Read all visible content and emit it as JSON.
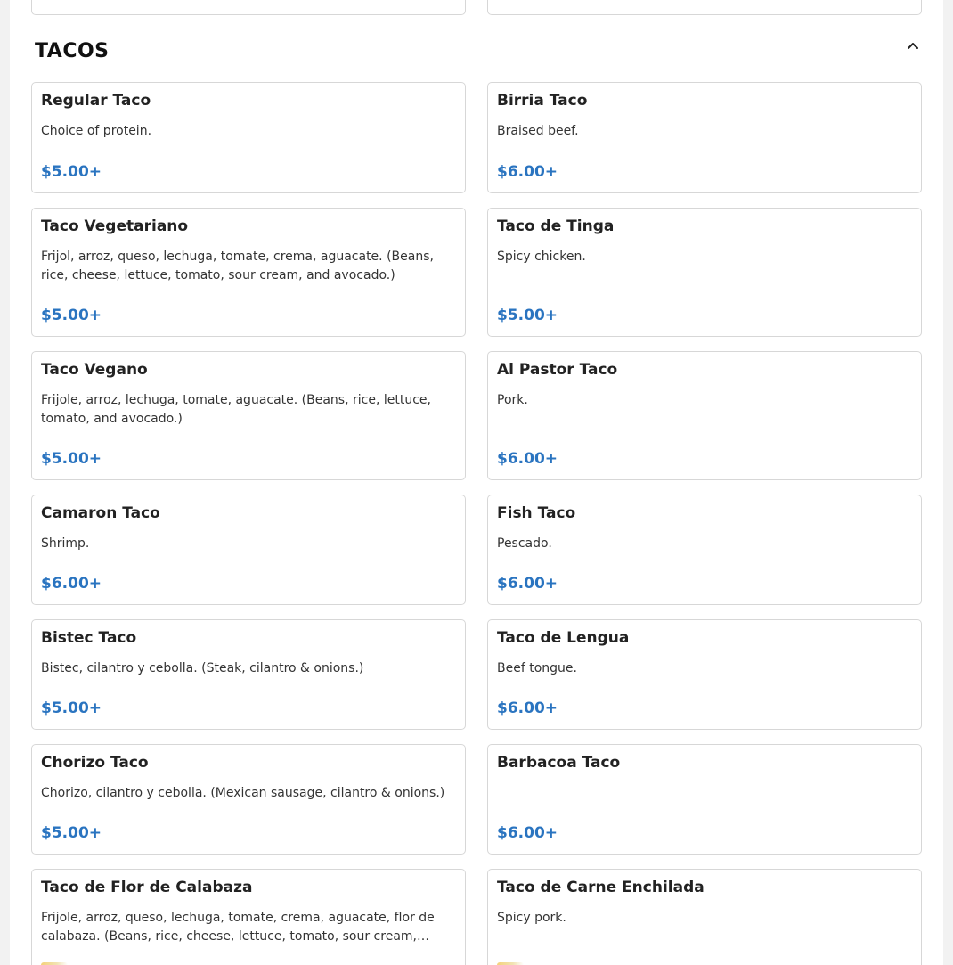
{
  "section": {
    "title": "TACOS"
  },
  "icons": {
    "collapse": "chevron-up-icon"
  },
  "colors": {
    "price": "#2a74c0",
    "card_border": "#d7d7d7"
  },
  "items": [
    {
      "name": "Regular Taco",
      "description": "Choice of protein.",
      "price": "$5.00+"
    },
    {
      "name": "Birria Taco",
      "description": "Braised beef.",
      "price": "$6.00+"
    },
    {
      "name": "Taco Vegetariano",
      "description": "Frijol, arroz, queso, lechuga, tomate, crema, aguacate. (Beans, rice, cheese, lettuce, tomato, sour cream, and avocado.)",
      "price": "$5.00+"
    },
    {
      "name": "Taco de Tinga",
      "description": "Spicy chicken.",
      "price": "$5.00+"
    },
    {
      "name": "Taco Vegano",
      "description": "Frijole, arroz, lechuga, tomate, aguacate. (Beans, rice, lettuce, tomato, and avocado.)",
      "price": "$5.00+"
    },
    {
      "name": "Al Pastor Taco",
      "description": "Pork.",
      "price": "$6.00+"
    },
    {
      "name": "Camaron Taco",
      "description": "Shrimp.",
      "price": "$6.00+"
    },
    {
      "name": "Fish Taco",
      "description": "Pescado.",
      "price": "$6.00+"
    },
    {
      "name": "Bistec Taco",
      "description": "Bistec, cilantro y cebolla. (Steak, cilantro & onions.)",
      "price": "$5.00+"
    },
    {
      "name": "Taco de Lengua",
      "description": "Beef tongue.",
      "price": "$6.00+"
    },
    {
      "name": "Chorizo Taco",
      "description": "Chorizo, cilantro y cebolla. (Mexican sausage, cilantro & onions.)",
      "price": "$5.00+"
    },
    {
      "name": "Barbacoa Taco",
      "description": "",
      "price": "$6.00+"
    },
    {
      "name": "Taco de Flor de Calabaza",
      "description": "Frijole, arroz, queso, lechuga, tomate, crema, aguacate, flor de calabaza. (Beans, rice, cheese, lettuce, tomato, sour cream,…",
      "price": ""
    },
    {
      "name": "Taco de Carne Enchilada",
      "description": "Spicy pork.",
      "price": ""
    }
  ]
}
